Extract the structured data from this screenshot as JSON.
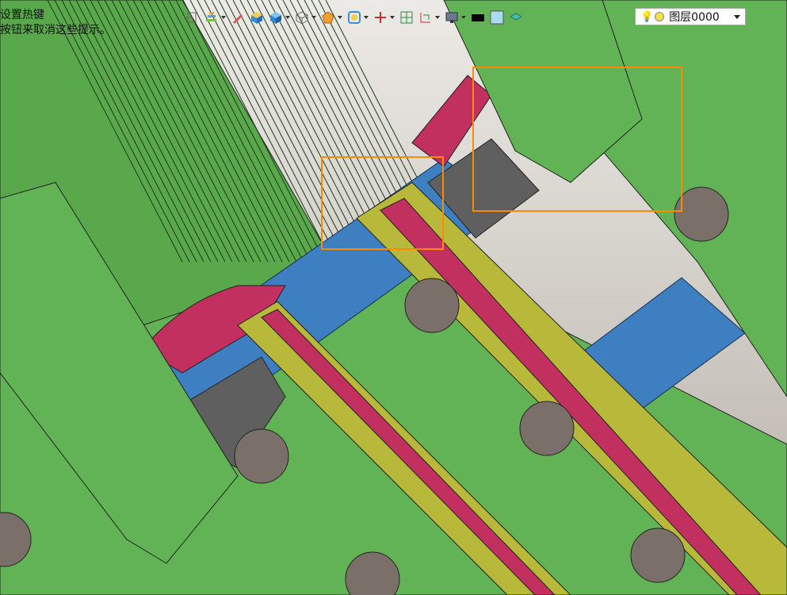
{
  "hint_lines": [
    "设置热键",
    "按钮来取消这些提示。"
  ],
  "toolbar": {
    "items": [
      {
        "icon": "exit-icon",
        "dropdown": false
      },
      {
        "icon": "layer-stack-icon",
        "dropdown": true
      },
      {
        "icon": "pencil-icon",
        "dropdown": false
      },
      {
        "icon": "shaded-cube-icon",
        "dropdown": false
      },
      {
        "icon": "blue-cube-icon",
        "dropdown": true
      },
      {
        "icon": "wireframe-cube-icon",
        "dropdown": true
      },
      {
        "icon": "polygon-icon",
        "dropdown": true
      },
      {
        "icon": "view-target-icon",
        "dropdown": true
      },
      {
        "icon": "axis-icon",
        "dropdown": true
      },
      {
        "icon": "grid-icon",
        "dropdown": false
      },
      {
        "icon": "dimension-icon",
        "dropdown": true
      },
      {
        "icon": "monitor-icon",
        "dropdown": true
      },
      {
        "icon": "color-black-icon",
        "dropdown": false
      },
      {
        "icon": "color-lightblue-icon",
        "dropdown": false
      },
      {
        "icon": "layers-icon",
        "dropdown": false
      }
    ]
  },
  "layer_select": {
    "value": "图层0000"
  },
  "colors": {
    "part_green": "#62b355",
    "rail_blue": "#3d7fc0",
    "rail_yellow": "#b8b83a",
    "rail_magenta": "#c2305f",
    "block_gray": "#5f5f5f",
    "hole_brown": "#7b7069",
    "selection": "#ff8a00",
    "background": "#d9d6d0"
  }
}
